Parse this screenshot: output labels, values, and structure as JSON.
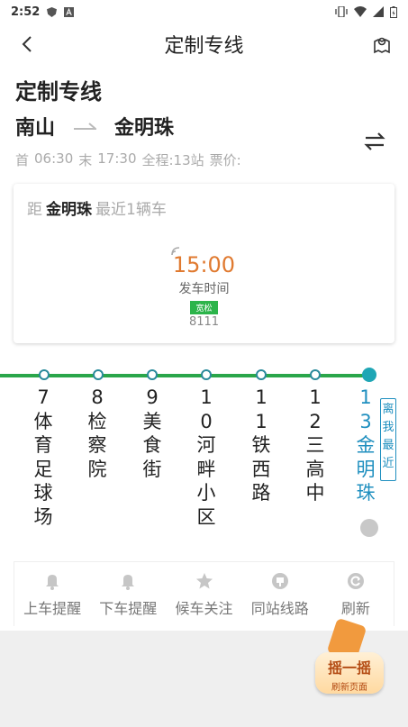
{
  "status_bar": {
    "time": "2:52"
  },
  "header": {
    "title": "定制专线"
  },
  "line": {
    "name": "定制专线",
    "from": "南山",
    "to": "金明珠",
    "first_label": "首",
    "first_time": "06:30",
    "last_label": "末",
    "last_time": "17:30",
    "total": "全程:13站",
    "fare": "票价:"
  },
  "card": {
    "prefix": "距",
    "stop": "金明珠",
    "nearest": "最近1辆车",
    "time": "15:00",
    "time_label": "发车时间",
    "crowd": "宽松",
    "plate": "8111"
  },
  "stops": [
    {
      "num": "7",
      "name": [
        "体",
        "育",
        "足",
        "球",
        "场"
      ]
    },
    {
      "num": "8",
      "name": [
        "检",
        "察",
        "院"
      ]
    },
    {
      "num": "9",
      "name": [
        "美",
        "食",
        "街"
      ]
    },
    {
      "num": "10",
      "name": [
        "河",
        "畔",
        "小",
        "区"
      ]
    },
    {
      "num": "11",
      "name": [
        "铁",
        "西",
        "路"
      ]
    },
    {
      "num": "12",
      "name": [
        "三",
        "高",
        "中"
      ]
    },
    {
      "num": "13",
      "name": [
        "金",
        "明",
        "珠"
      ]
    }
  ],
  "near_tag": "离我最近",
  "toolbar": [
    {
      "label": "上车提醒",
      "icon": "bell-icon"
    },
    {
      "label": "下车提醒",
      "icon": "bell-icon"
    },
    {
      "label": "候车关注",
      "icon": "star-icon"
    },
    {
      "label": "同站线路",
      "icon": "station-icon"
    },
    {
      "label": "刷新",
      "icon": "refresh-icon"
    }
  ],
  "shake": {
    "title": "摇一摇",
    "subtitle": "刷新页面"
  },
  "colors": {
    "accent_blue": "#1f8fbf",
    "rail_green": "#2aa64a",
    "time_orange": "#e07a30",
    "crowd_green": "#2cb44a"
  }
}
